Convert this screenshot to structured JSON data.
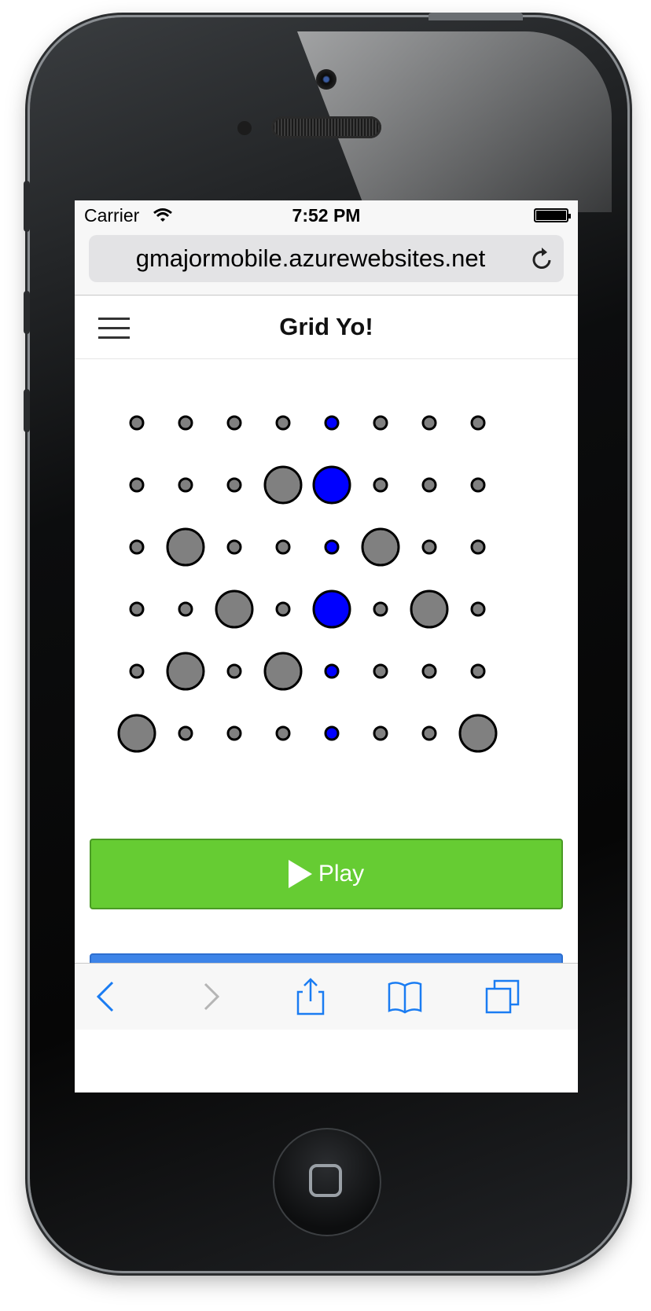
{
  "status_bar": {
    "carrier": "Carrier",
    "time": "7:52 PM"
  },
  "browser": {
    "url": "gmajormobile.azurewebsites.net",
    "reload_icon": "reload-icon"
  },
  "app": {
    "title": "Grid Yo!",
    "menu_icon": "hamburger-menu-icon",
    "play_label": "Play",
    "colors": {
      "play_button": "#66cc33",
      "active_dot": "#0000ff",
      "inactive_dot": "#808080",
      "secondary_button": "#3d84e8"
    }
  },
  "grid": {
    "rows": 6,
    "columns": 8,
    "active_column": 5,
    "large_cells": [
      [
        2,
        4
      ],
      [
        2,
        5
      ],
      [
        3,
        2
      ],
      [
        3,
        6
      ],
      [
        4,
        3
      ],
      [
        4,
        5
      ],
      [
        4,
        7
      ],
      [
        5,
        2
      ],
      [
        5,
        4
      ],
      [
        6,
        1
      ],
      [
        6,
        8
      ]
    ]
  },
  "toolbar": {
    "items": [
      "back-icon",
      "forward-icon",
      "share-icon",
      "bookmarks-icon",
      "tabs-icon"
    ]
  }
}
